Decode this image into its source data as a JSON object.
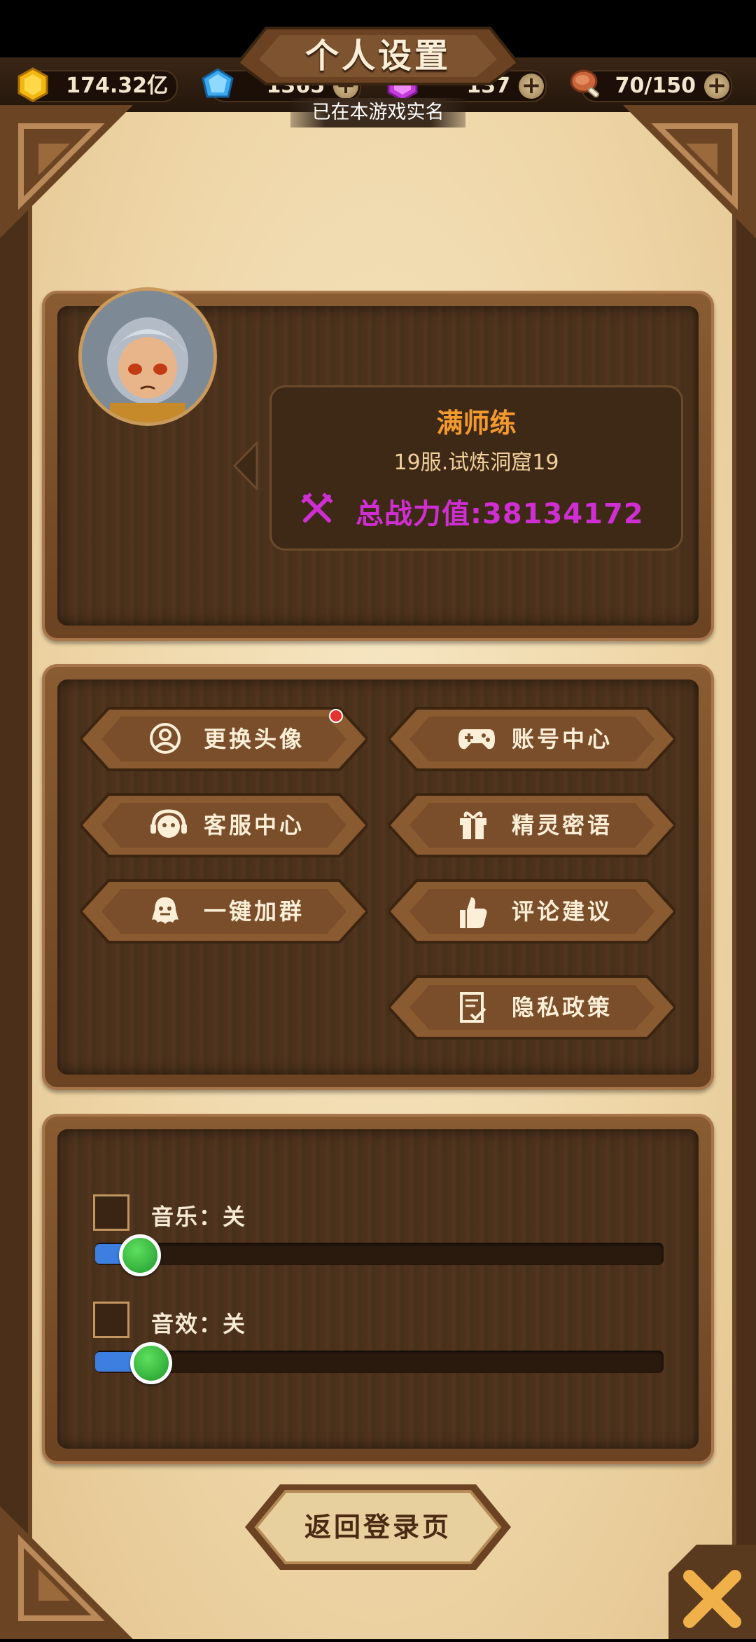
{
  "resources": {
    "gold": "174.32亿",
    "diamond": "1365",
    "crystal": "137",
    "stamina": "70/150"
  },
  "header": {
    "title": "个人设置",
    "verified_text": "已在本游戏实名"
  },
  "profile": {
    "name": "满师练",
    "server": "19服.试炼洞窟19",
    "power": "总战力值:38134172"
  },
  "buttons": {
    "change_avatar": "更换头像",
    "account_center": "账号中心",
    "customer_service": "客服中心",
    "spirit_code": "精灵密语",
    "join_group": "一键加群",
    "feedback": "评论建议",
    "privacy": "隐私政策",
    "back_to_login": "返回登录页"
  },
  "sound": {
    "music_label": "音乐：关",
    "music_enabled": false,
    "music_level": 0.05,
    "effects_label": "音效：关",
    "effects_enabled": false,
    "effects_level": 0.07
  },
  "colors": {
    "power_text": "#cf2fd2",
    "name_text": "#f29a2e",
    "notification_dot": "#e3342f",
    "slider_fill": "#3d7fe0",
    "slider_knob": "#2fbf3a"
  },
  "icons": [
    "gold-coin-icon",
    "diamond-icon",
    "purple-gem-icon",
    "meat-icon",
    "plus-icon",
    "crossed-swords-icon",
    "user-circle-icon",
    "gamepad-icon",
    "headset-icon",
    "gift-icon",
    "ghost-icon",
    "thumbs-up-icon",
    "document-check-icon",
    "close-icon"
  ]
}
